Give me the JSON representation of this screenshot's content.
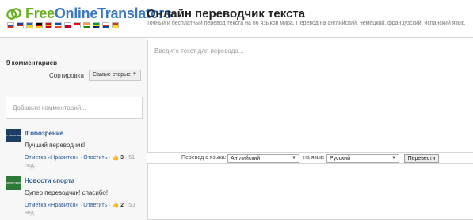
{
  "header": {
    "logo": {
      "part1": "Free",
      "part2": "OnlineTranslators"
    },
    "flags": [
      {
        "name": "russian",
        "colors": [
          "#ffffff",
          "#2d56b3",
          "#d52b1e"
        ]
      },
      {
        "name": "english",
        "colors": [
          "#1f3f8f",
          "#d52b1e",
          "#ffffff"
        ]
      },
      {
        "name": "ukrainian",
        "colors": [
          "#2b64c8",
          "#ffd500"
        ]
      },
      {
        "name": "german",
        "colors": [
          "#000000",
          "#dd0000",
          "#ffce00"
        ]
      },
      {
        "name": "spanish",
        "colors": [
          "#c60b1e",
          "#ffc400",
          "#c60b1e"
        ]
      },
      {
        "name": "french",
        "colors": [
          "#0055a4",
          "#ffffff",
          "#ef4135"
        ]
      },
      {
        "name": "japanese",
        "colors": [
          "#ffffff",
          "#bc002d"
        ]
      },
      {
        "name": "turkish",
        "colors": [
          "#e30a17",
          "#ffffff"
        ]
      },
      {
        "name": "indian",
        "colors": [
          "#ff9933",
          "#ffffff",
          "#138808"
        ]
      },
      {
        "name": "brazilian",
        "colors": [
          "#009c3b",
          "#ffdf00",
          "#002776"
        ]
      },
      {
        "name": "korean",
        "colors": [
          "#ffffff",
          "#cd2e3a",
          "#0047a0"
        ]
      },
      {
        "name": "chinese",
        "colors": [
          "#de2910",
          "#ffde00"
        ]
      }
    ],
    "title": "Онлайн переводчик текста",
    "subtitle": "Точный и бесплатный перевод текста на 86 языков мира. Перевод на английский, немецкий, французский, испанский язык."
  },
  "comments_panel": {
    "count_label": "9 комментариев",
    "sort_label": "Сортировка",
    "sort_value": "Самые старые",
    "comment_placeholder": "Добавьте комментарий...",
    "comments": [
      {
        "author": "It обозрение",
        "avatar_text": "IT ОБЗОРЕНИЕ",
        "text": "Лучший переводчик!",
        "like_label": "Отметка «Нравится»",
        "reply_label": "Ответить",
        "likes": "3",
        "age": "51 нед."
      },
      {
        "author": "Новости спорта",
        "avatar_text": "SPORT NEWS",
        "text": "Супер переводчик! спасибо!",
        "like_label": "Отметка «Нравится»",
        "reply_label": "Ответить",
        "likes": "2",
        "age": "50 нед."
      }
    ]
  },
  "translator": {
    "source_placeholder": "Введите текст для перевода...",
    "from_label": "Перевод с языка:",
    "from_value": "Английский",
    "to_label": "на язык:",
    "to_value": "Русский",
    "translate_button": "Перевести"
  },
  "icons": {
    "logo": "interlocking-rings-icon",
    "like": "thumbs-up-icon",
    "caret": "chevron-down-icon"
  }
}
